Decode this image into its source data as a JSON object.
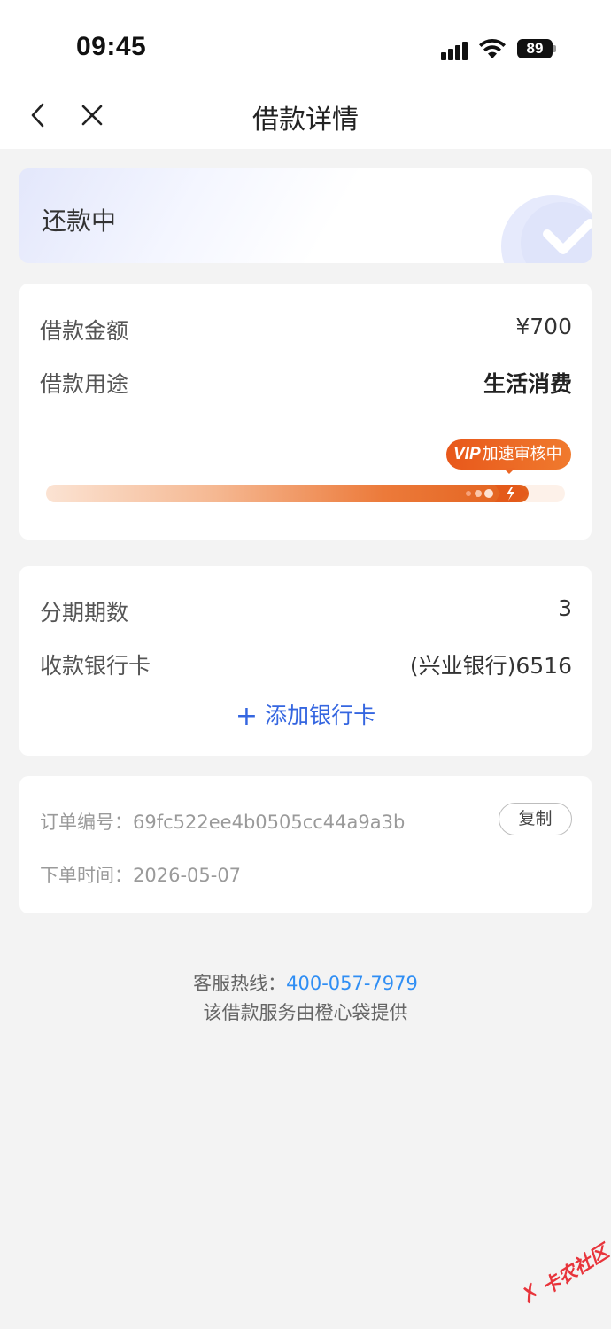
{
  "status_bar": {
    "time": "09:45",
    "battery": "89",
    "icons": [
      "signal-icon",
      "wifi-icon",
      "battery-icon"
    ]
  },
  "nav": {
    "title": "借款详情",
    "back_icon": "chevron-left-icon",
    "close_icon": "close-icon"
  },
  "status_card": {
    "status": "还款中",
    "icon": "check-circle-icon"
  },
  "loan": {
    "amount_label": "借款金额",
    "amount_value": "¥700",
    "purpose_label": "借款用途",
    "purpose_value": "生活消费",
    "vip_mark": "VIP",
    "vip_text": "加速审核中",
    "progress_fraction": 0.93
  },
  "repayment": {
    "installments_label": "分期期数",
    "installments_value": "3",
    "bank_label": "收款银行卡",
    "bank_value": "(兴业银行)6516",
    "add_card_label": "添加银行卡"
  },
  "order": {
    "id_label": "订单编号：",
    "id_value": "69fc522ee4b0505cc44a9a3b",
    "copy_label": "复制",
    "time_label": "下单时间：",
    "time_value": "2026-05-07"
  },
  "footer": {
    "hotline_label": "客服热线：",
    "hotline_number": "400-057-7979",
    "provider_text": "该借款服务由橙心袋提供"
  },
  "watermark": {
    "text": "卡农社区"
  },
  "colors": {
    "accent_blue": "#3566e0",
    "link_blue": "#2f8ef4",
    "progress_orange": "#e2601c",
    "page_bg": "#f3f3f3"
  }
}
